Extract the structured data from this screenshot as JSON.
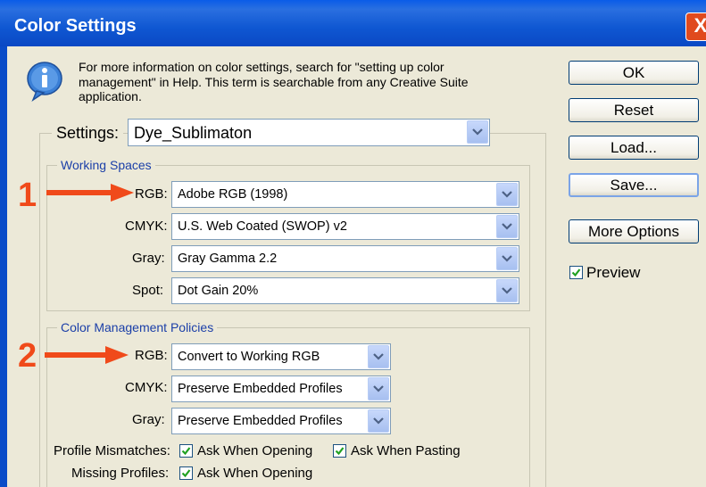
{
  "window": {
    "title": "Color Settings",
    "close_glyph": "X"
  },
  "info": {
    "icon": "info-icon",
    "text": "For more information on color settings, search for \"setting up color management\" in Help. This term is searchable from any Creative Suite application."
  },
  "settings": {
    "label": "Settings:",
    "value": "Dye_Sublimaton"
  },
  "working_spaces": {
    "title": "Working Spaces",
    "rows": [
      {
        "label": "RGB:",
        "value": "Adobe RGB (1998)"
      },
      {
        "label": "CMYK:",
        "value": "U.S. Web Coated (SWOP) v2"
      },
      {
        "label": "Gray:",
        "value": "Gray Gamma 2.2"
      },
      {
        "label": "Spot:",
        "value": "Dot Gain 20%"
      }
    ]
  },
  "policies": {
    "title": "Color Management Policies",
    "rows": [
      {
        "label": "RGB:",
        "value": "Convert to Working RGB"
      },
      {
        "label": "CMYK:",
        "value": "Preserve Embedded Profiles"
      },
      {
        "label": "Gray:",
        "value": "Preserve Embedded Profiles"
      }
    ],
    "mismatch_label": "Profile Mismatches:",
    "mismatch_open": "Ask When Opening",
    "mismatch_paste": "Ask When Pasting",
    "missing_label": "Missing Profiles:",
    "missing_open": "Ask When Opening"
  },
  "buttons": {
    "ok": "OK",
    "reset": "Reset",
    "load": "Load...",
    "save": "Save...",
    "more": "More Options"
  },
  "preview": {
    "label": "Preview",
    "checked": true
  },
  "annotations": {
    "one": "1",
    "two": "2",
    "color": "#f04a1a"
  }
}
